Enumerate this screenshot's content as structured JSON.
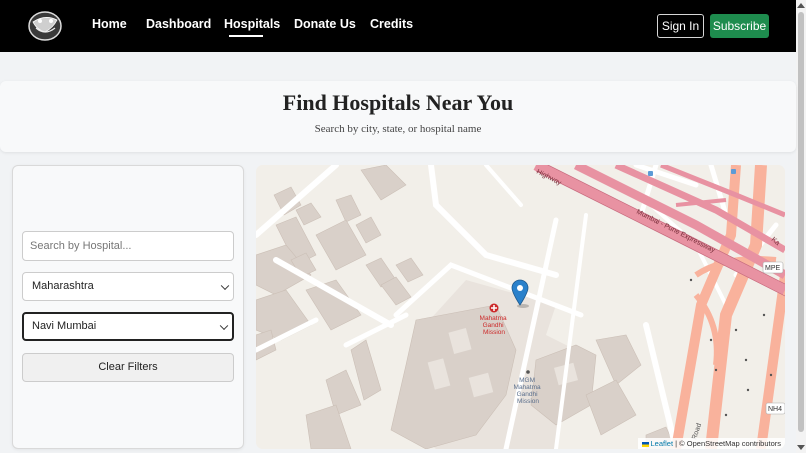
{
  "nav": {
    "links": [
      "Home",
      "Dashboard",
      "Hospitals",
      "Donate Us",
      "Credits"
    ],
    "active": "Hospitals",
    "signin_label": "Sign In",
    "subscribe_label": "Subscribe"
  },
  "hero": {
    "title": "Find Hospitals Near You",
    "subtitle": "Search by city, state, or hospital name"
  },
  "filters": {
    "search_placeholder": "Search by Hospital...",
    "state_value": "Maharashtra",
    "city_value": "Navi Mumbai",
    "clear_label": "Clear Filters"
  },
  "map": {
    "labels": {
      "hospital": [
        "Mahatma",
        "Gandhi",
        "Mission"
      ],
      "mgm": [
        "MGM",
        "Mahatma",
        "Gandhi",
        "Mission"
      ],
      "expressway": "Mumbai - Pune Expressway",
      "highway": "Highway",
      "mpe": "MPE",
      "nh4": "NH4",
      "road": "Road",
      "ka": "Ka"
    },
    "attribution": {
      "leaflet": "Leaflet",
      "sep": " | © ",
      "osm": "OpenStreetMap contributors"
    }
  },
  "colors": {
    "accent": "#1e8c4e",
    "navbar": "#000000",
    "marker": "#2a81cb",
    "motorway": "#e892a2",
    "trunk": "#f9b29c"
  }
}
